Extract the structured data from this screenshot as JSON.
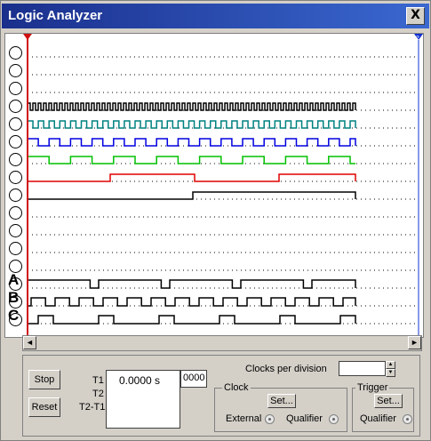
{
  "window": {
    "title": "Logic Analyzer",
    "close_glyph": "X"
  },
  "markers": {
    "t1": "1",
    "t2": "2",
    "t1_color": "#d01010",
    "t2_color": "#1030d0"
  },
  "channel_labels": {
    "a": "A",
    "b": "B",
    "c": "C"
  },
  "scroll": {
    "left": "◄",
    "right": "►"
  },
  "controls": {
    "stop_label": "Stop",
    "reset_label": "Reset",
    "t1_label": "T1",
    "t2_label": "T2",
    "t2t1_label": "T2-T1",
    "t1_value": "0.0000  s",
    "count_value": "0000",
    "clocks_per_division_label": "Clocks per division",
    "clocks_per_division_value": "",
    "clock_group_label": "Clock",
    "clock_set_label": "Set...",
    "external_label": "External",
    "qualifier_label": "Qualifier",
    "trigger_group_label": "Trigger",
    "trigger_set_label": "Set...",
    "trigger_qualifier_label": "Qualifier"
  },
  "trace_colors": {
    "ch3": "#000000",
    "ch4": "#008080",
    "ch5": "#0000e0",
    "ch6": "#00c000",
    "ch7": "#e00000",
    "ch8": "#000000",
    "ch14": "#000000",
    "ch15": "#000000",
    "ch16": "#000000"
  }
}
